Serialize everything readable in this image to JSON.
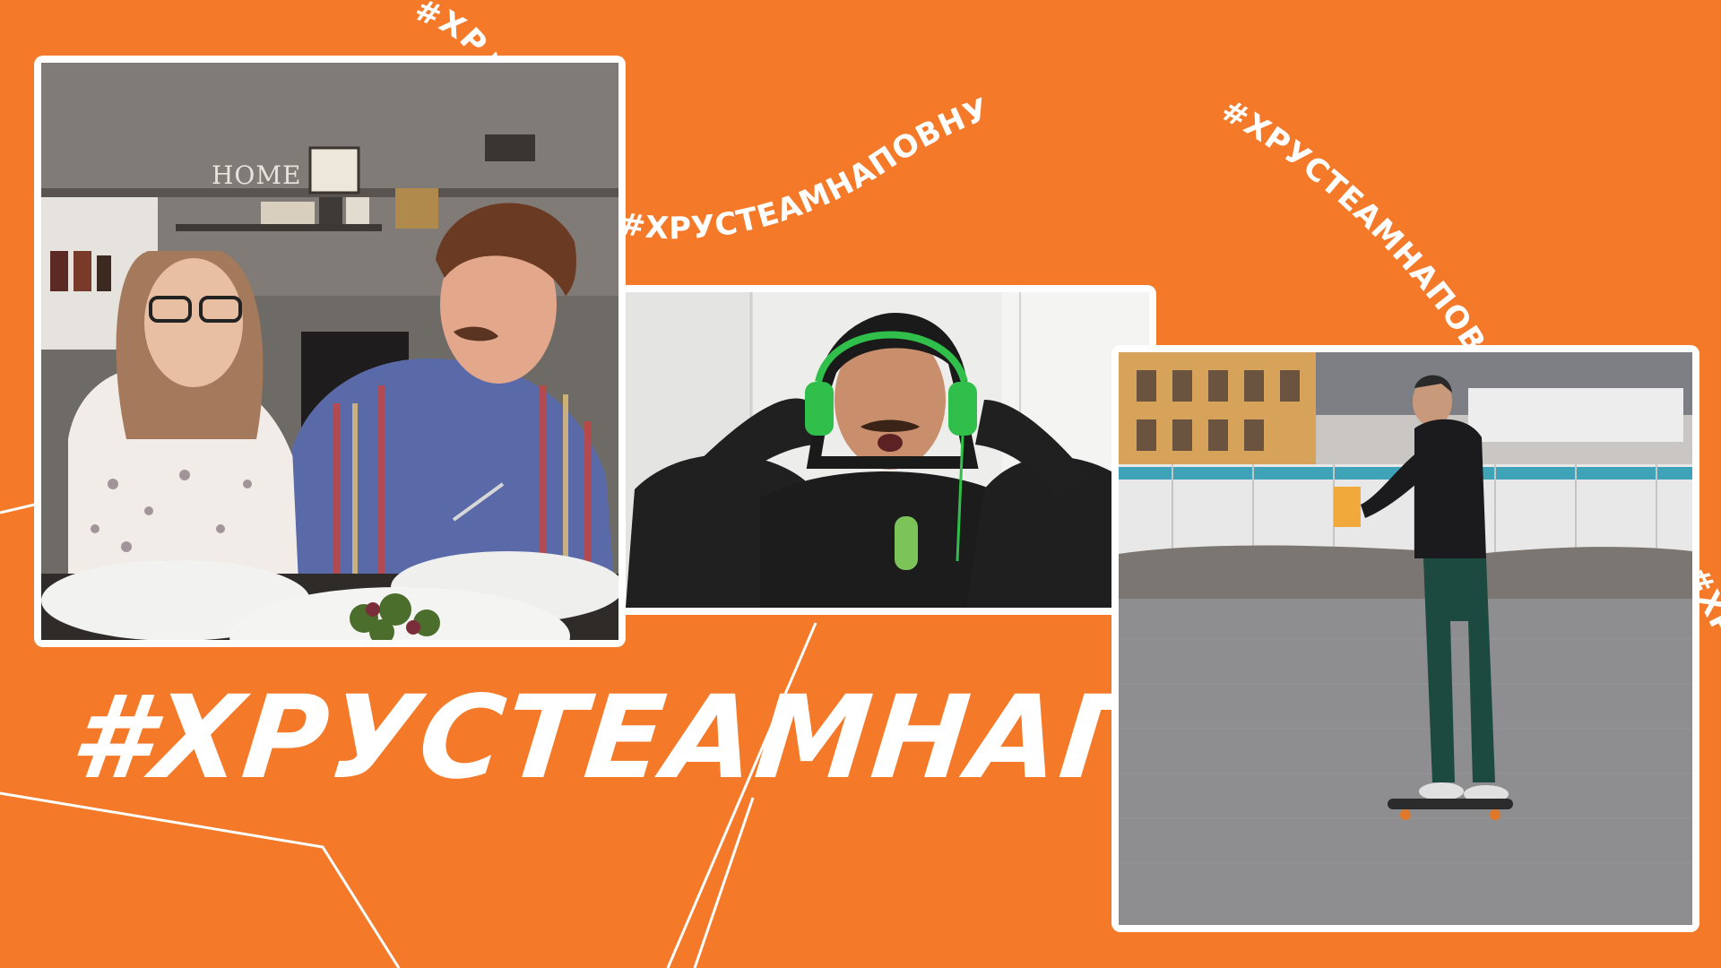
{
  "background_color": "#F47A2A",
  "accent_color": "#FFFFFF",
  "curved_hashtags": [
    {
      "text": "#ХРУСТЕАМНАПОВНУ"
    },
    {
      "text": "#ХРУСТЕАМНАПОВНУ"
    },
    {
      "text": "#ХРУСТЕАМНАПОВНУ"
    },
    {
      "text": "#ХРУСТЕАМНАП"
    }
  ],
  "big_hashtag": "#ХРУСТЕАМНАП",
  "photos": [
    {
      "sign_text": "HOME"
    }
  ]
}
